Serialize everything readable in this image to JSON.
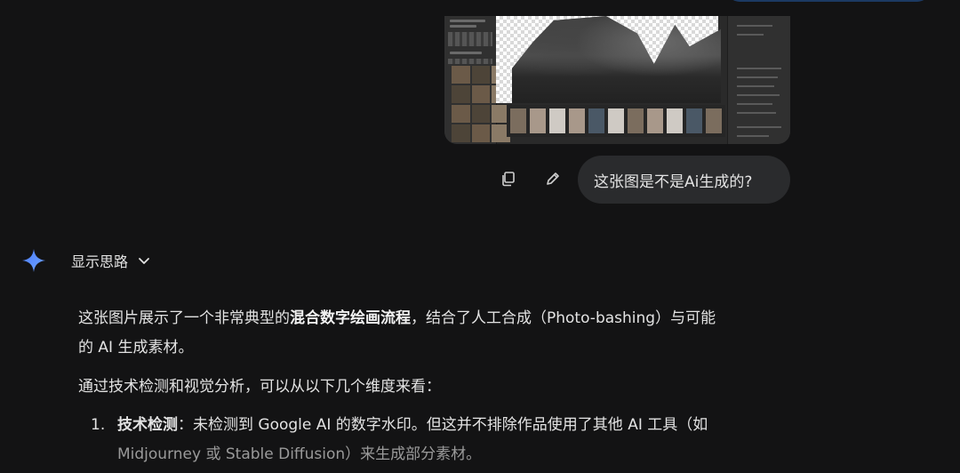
{
  "user_message": {
    "text": "这张图是不是Ai生成的?"
  },
  "actions": {
    "copy_icon": "copy-icon",
    "edit_icon": "pencil-icon"
  },
  "response": {
    "show_thoughts_label": "显示思路",
    "para1_part1": "这张图片展示了一个非常典型的",
    "para1_bold": "混合数字绘画流程",
    "para1_part2": "，结合了人工合成（Photo-bashing）与可能",
    "para1_line2": "的 AI 生成素材。",
    "para2": "通过技术检测和视觉分析，可以从以下几个维度来看：",
    "list": [
      {
        "number": "1.",
        "title": "技术检测",
        "text_line1": "：未检测到 Google AI 的数字水印。但这并不排除作品使用了其他 AI 工具（如",
        "text_line2": "Midjourney 或 Stable Diffusion）来生成部分素材。"
      }
    ]
  },
  "colors": {
    "background": "#131314",
    "bubble": "#2a2b2d",
    "text": "#e3e3e3",
    "gemini_star_start": "#4a7cff",
    "gemini_star_end": "#6fa3ff"
  }
}
